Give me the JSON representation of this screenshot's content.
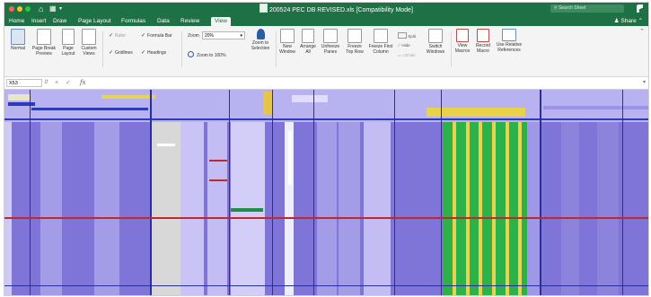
{
  "app": {
    "window_title": "200524 PEC DB REVISED.xls [Compatibility Mode]",
    "search_placeholder": "Search Sheet",
    "share_label": "Share"
  },
  "tabs": [
    {
      "label": "Home",
      "active": false
    },
    {
      "label": "Insert",
      "active": false
    },
    {
      "label": "Draw",
      "active": false
    },
    {
      "label": "Page Layout",
      "active": false
    },
    {
      "label": "Formulas",
      "active": false
    },
    {
      "label": "Data",
      "active": false
    },
    {
      "label": "Review",
      "active": false
    },
    {
      "label": "View",
      "active": true
    }
  ],
  "ribbon": {
    "workbook_views": [
      {
        "label": "Normal",
        "icon": "normal-view-icon"
      },
      {
        "label": "Page Break\nPreview",
        "icon": "page-break-preview-icon"
      },
      {
        "label": "Page\nLayout",
        "icon": "page-layout-icon"
      },
      {
        "label": "Custom\nViews",
        "icon": "custom-views-icon"
      }
    ],
    "show": {
      "ruler": {
        "label": "Ruler",
        "checked": true,
        "enabled": false
      },
      "formula_bar": {
        "label": "Formula Bar",
        "checked": true
      },
      "gridlines": {
        "label": "Gridlines",
        "checked": true
      },
      "headings": {
        "label": "Headings",
        "checked": true
      }
    },
    "zoom": {
      "label": "Zoom",
      "value": "20%",
      "zoom_100_label": "Zoom to 100%"
    },
    "zoom_to_selection": "Zoom to\nSelection",
    "window_group": [
      {
        "label": "New\nWindow",
        "icon": "new-window-icon"
      },
      {
        "label": "Arrange\nAll",
        "icon": "arrange-all-icon"
      },
      {
        "label": "Unfreeze\nPanes",
        "icon": "unfreeze-panes-icon"
      },
      {
        "label": "Freeze\nTop Row",
        "icon": "freeze-top-row-icon"
      },
      {
        "label": "Freeze First\nColumn",
        "icon": "freeze-first-column-icon"
      }
    ],
    "split_label": "Split",
    "hide_label": "Hide",
    "unhide_label": "Unhide",
    "switch_windows": "Switch\nWindows",
    "macros": [
      {
        "label": "View\nMacros",
        "icon": "view-macros-icon"
      },
      {
        "label": "Record\nMacro",
        "icon": "record-macro-icon"
      },
      {
        "label": "Use Relative\nReferences",
        "icon": "relative-references-icon"
      }
    ]
  },
  "formula_bar": {
    "name_box": "X53",
    "fx_label": "fx",
    "formula": ""
  },
  "colors": {
    "excel_green": "#1e7145",
    "sheet_fill": "#7f75d8",
    "red_line": "#c0282e",
    "green_columns": "#2db24a",
    "yellow_columns": "#e9d24f"
  }
}
